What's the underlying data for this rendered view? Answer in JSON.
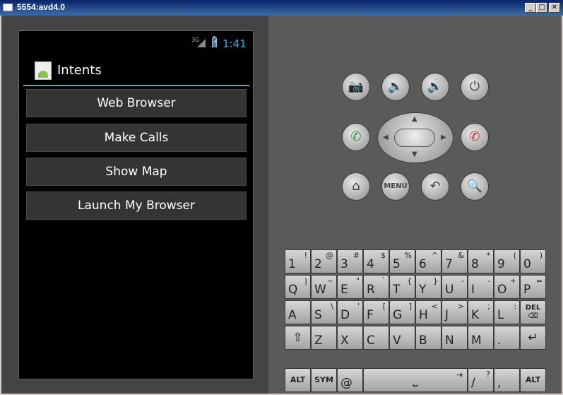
{
  "window": {
    "title": "5554:avd4.0",
    "min_label": "_",
    "max_label": "□",
    "close_label": "✕"
  },
  "status": {
    "network": "3G",
    "time": "1:41",
    "battery_bolt": "⚡"
  },
  "app": {
    "title": "Intents"
  },
  "buttons": [
    "Web Browser",
    "Make Calls",
    "Show Map",
    "Launch My Browser"
  ],
  "controls": {
    "camera_icon": "camera-icon",
    "camera": "📷",
    "vol_down": "🔉",
    "vol_up": "🔊",
    "power": "⏻",
    "call": "✆",
    "end_call": "✆",
    "home": "⌂",
    "menu": "MENU",
    "back": "↶",
    "search": "🔍",
    "dpad": {
      "up": "▲",
      "down": "▼",
      "left": "◀",
      "right": "▶"
    }
  },
  "keyboard": {
    "row1": [
      {
        "p": "1",
        "s": "!"
      },
      {
        "p": "2",
        "s": "@"
      },
      {
        "p": "3",
        "s": "#"
      },
      {
        "p": "4",
        "s": "$"
      },
      {
        "p": "5",
        "s": "%"
      },
      {
        "p": "6",
        "s": "^"
      },
      {
        "p": "7",
        "s": "&"
      },
      {
        "p": "8",
        "s": "*"
      },
      {
        "p": "9",
        "s": "("
      },
      {
        "p": "0",
        "s": ")"
      }
    ],
    "row2": [
      {
        "p": "Q",
        "s": "|"
      },
      {
        "p": "W",
        "s": "~"
      },
      {
        "p": "E",
        "s": "\""
      },
      {
        "p": "R",
        "s": "`"
      },
      {
        "p": "T",
        "s": "{"
      },
      {
        "p": "Y",
        "s": "}"
      },
      {
        "p": "U",
        "s": "-"
      },
      {
        "p": "I",
        "s": "-"
      },
      {
        "p": "O",
        "s": "+"
      },
      {
        "p": "P",
        "s": "="
      }
    ],
    "row3": [
      {
        "p": "A",
        "s": ""
      },
      {
        "p": "S",
        "s": "\\"
      },
      {
        "p": "D",
        "s": "'"
      },
      {
        "p": "F",
        "s": "["
      },
      {
        "p": "G",
        "s": "]"
      },
      {
        "p": "H",
        "s": "<"
      },
      {
        "p": "J",
        "s": ">"
      },
      {
        "p": "K",
        "s": ";"
      },
      {
        "p": "L",
        "s": ":"
      }
    ],
    "del": "DEL ⌫",
    "shift": "⇧",
    "row4": [
      {
        "p": "Z",
        "s": ""
      },
      {
        "p": "X",
        "s": ""
      },
      {
        "p": "C",
        "s": ""
      },
      {
        "p": "V",
        "s": ""
      },
      {
        "p": "B",
        "s": ""
      },
      {
        "p": "N",
        "s": ""
      },
      {
        "p": "M",
        "s": ""
      },
      {
        "p": ".",
        "s": ""
      }
    ],
    "enter": "↵",
    "alt": "ALT",
    "sym": "SYM",
    "at": "@",
    "space_glyph": "⎵",
    "tab_glyph": "⇥",
    "slash": {
      "p": "/",
      "s": "?"
    },
    "comma": ","
  }
}
